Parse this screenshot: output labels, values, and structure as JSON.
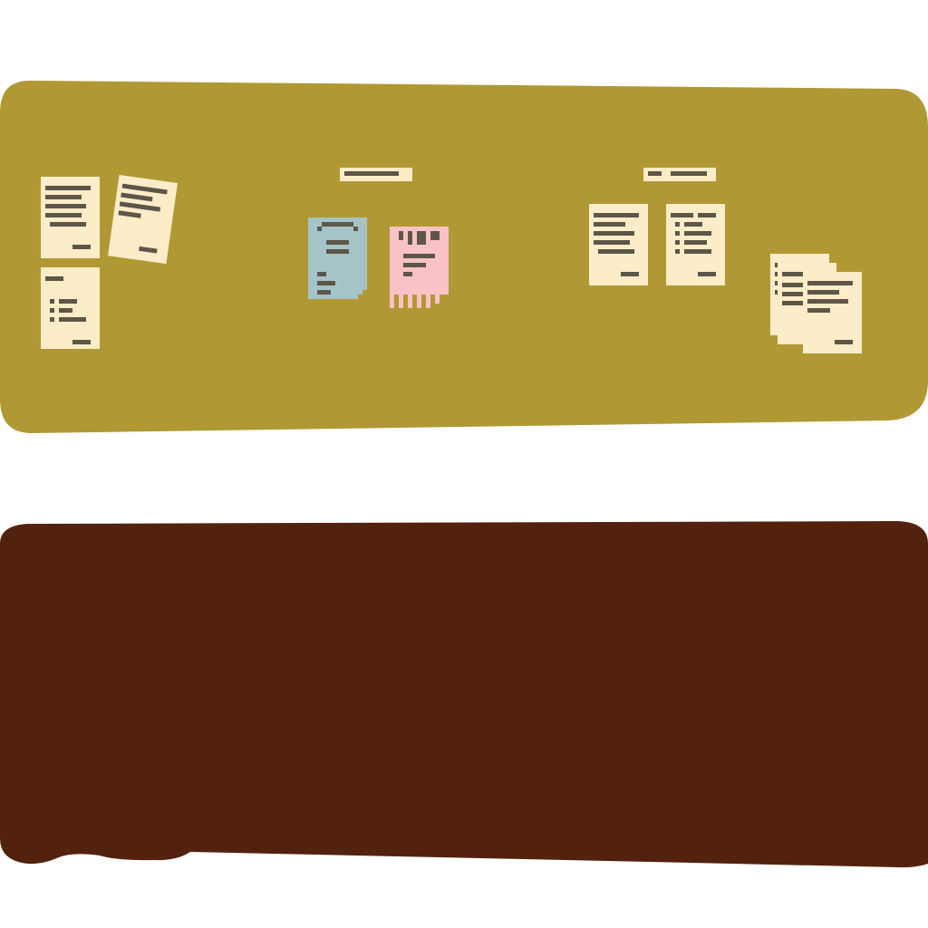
{
  "colors": {
    "background": "#ffffff",
    "board": "#b09934",
    "floor": "#52220e",
    "paper": "#fdecc8",
    "receipt_blue": "#a4c4c8",
    "receipt_pink": "#fac2c6",
    "ink": "#5d5649"
  },
  "scene": {
    "board": {
      "label_tags": [
        "blank-label-tag",
        "blank-label-tag"
      ]
    },
    "documents": [
      {
        "kind": "paper-document",
        "icon": "text-lines-icon"
      },
      {
        "kind": "paper-document",
        "icon": "text-lines-icon",
        "tilted": true
      },
      {
        "kind": "paper-document",
        "icon": "checklist-icon"
      },
      {
        "kind": "blue-receipt",
        "icon": "receipt-icon"
      },
      {
        "kind": "pink-ticket",
        "icon": "barcode-icon"
      },
      {
        "kind": "paper-document",
        "icon": "text-lines-icon"
      },
      {
        "kind": "paper-document",
        "icon": "checklist-icon"
      },
      {
        "kind": "document-stack",
        "icon": "stack-icon",
        "count": 3
      }
    ]
  }
}
